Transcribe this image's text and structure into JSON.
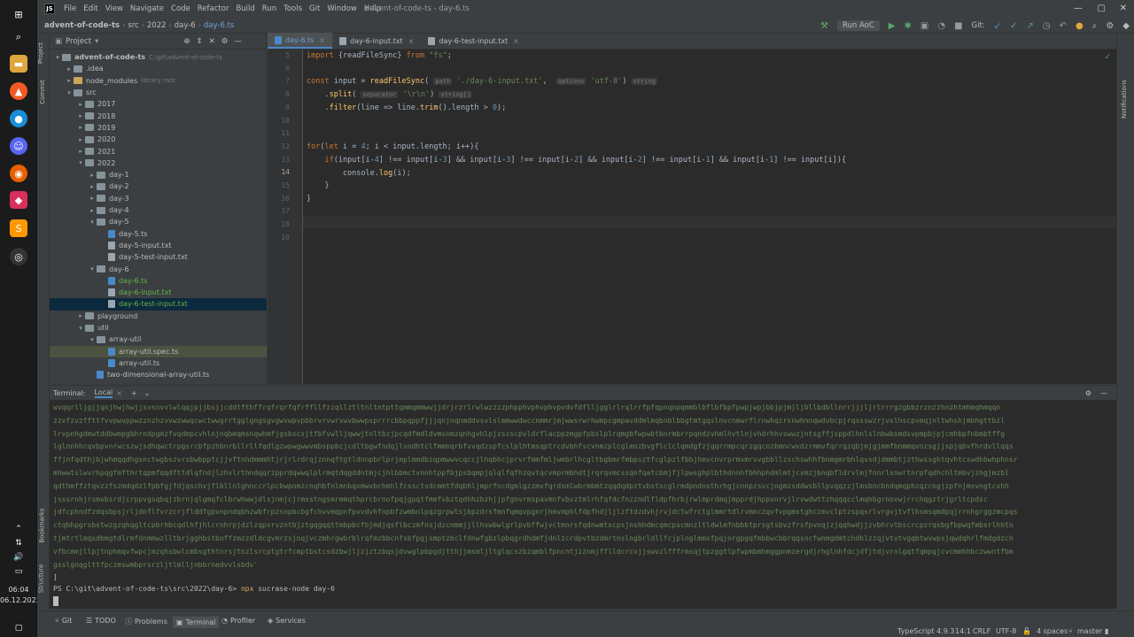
{
  "taskbar": {
    "time": "06:04",
    "date": "06.12.2022"
  },
  "menubar": {
    "items": [
      "File",
      "Edit",
      "View",
      "Navigate",
      "Code",
      "Refactor",
      "Build",
      "Run",
      "Tools",
      "Git",
      "Window",
      "Help"
    ],
    "title": "advent-of-code-ts - day-6.ts"
  },
  "navbar": {
    "crumbs": [
      "advent-of-code-ts",
      "src",
      "2022",
      "day-6",
      "day-6.ts"
    ],
    "run_config": "Run AoC",
    "git_label": "Git:"
  },
  "project": {
    "header": "Project",
    "items": [
      {
        "label": "advent-of-code-ts",
        "suffix": "C:\\git\\advent-of-code-ts",
        "level": 0,
        "type": "folder",
        "open": true
      },
      {
        "label": ".idea",
        "level": 1,
        "type": "folder",
        "open": false
      },
      {
        "label": "node_modules",
        "suffix": "library root",
        "level": 1,
        "type": "folder",
        "open": false
      },
      {
        "label": "src",
        "level": 1,
        "type": "folder",
        "open": true
      },
      {
        "label": "2017",
        "level": 2,
        "type": "folder",
        "open": false
      },
      {
        "label": "2018",
        "level": 2,
        "type": "folder",
        "open": false
      },
      {
        "label": "2019",
        "level": 2,
        "type": "folder",
        "open": false
      },
      {
        "label": "2020",
        "level": 2,
        "type": "folder",
        "open": false
      },
      {
        "label": "2021",
        "level": 2,
        "type": "folder",
        "open": false
      },
      {
        "label": "2022",
        "level": 2,
        "type": "folder",
        "open": true
      },
      {
        "label": "day-1",
        "level": 3,
        "type": "folder",
        "open": false
      },
      {
        "label": "day-2",
        "level": 3,
        "type": "folder",
        "open": false
      },
      {
        "label": "day-3",
        "level": 3,
        "type": "folder",
        "open": false
      },
      {
        "label": "day-4",
        "level": 3,
        "type": "folder",
        "open": false
      },
      {
        "label": "day-5",
        "level": 3,
        "type": "folder",
        "open": true
      },
      {
        "label": "day-5.ts",
        "level": 4,
        "type": "ts"
      },
      {
        "label": "day-5-input.txt",
        "level": 4,
        "type": "txt"
      },
      {
        "label": "day-5-test-input.txt",
        "level": 4,
        "type": "txt"
      },
      {
        "label": "day-6",
        "level": 3,
        "type": "folder",
        "open": true
      },
      {
        "label": "day-6.ts",
        "level": 4,
        "type": "ts",
        "green": true
      },
      {
        "label": "day-6-input.txt",
        "level": 4,
        "type": "txt",
        "green": true
      },
      {
        "label": "day-6-test-input.txt",
        "level": 4,
        "type": "txt",
        "green": true,
        "selected": true
      },
      {
        "label": "playground",
        "level": 2,
        "type": "folder",
        "open": false
      },
      {
        "label": "util",
        "level": 2,
        "type": "folder",
        "open": true
      },
      {
        "label": "array-util",
        "level": 3,
        "type": "folder",
        "open": true
      },
      {
        "label": "array-util.spec.ts",
        "level": 4,
        "type": "ts",
        "highlight": true
      },
      {
        "label": "array-util.ts",
        "level": 4,
        "type": "ts"
      },
      {
        "label": "two-dimensional-array-util.ts",
        "level": 3,
        "type": "ts"
      }
    ]
  },
  "editor": {
    "tabs": [
      "day-6.ts",
      "day-6-input.txt",
      "day-6-test-input.txt"
    ],
    "line_numbers": [
      "5",
      "6",
      "7",
      "8",
      "9",
      "10",
      "11",
      "12",
      "13",
      "14",
      "15",
      "16",
      "17",
      "18",
      "19"
    ]
  },
  "terminal": {
    "label": "Terminal:",
    "tab": "Local",
    "output": [
      "wvqqrlljgjjqnjhwjhwjjsvsnvvlwlqqjpjjbsjjcddtfthffrqfrqrfqfrffllfzzqllztltnltntpttqmmqmmwwjjdrjrzrlrwlwzzzzphpphvphvphvpvdvfdflljgglrlrqlrrfpfqpnqnpqmmblbflbfbpfpwpjwpjbbjpjmjljbllbdbllnrrjjjljrlrrrgzgbbzrznzzhnzhtmhmqhmqqn",
      "zzvfzvzffttfvvpwvppwzznzhzvvwzwwqcwctwwgrrtgglgngsgvgwvwpvpbbrvrvwrvwvbwwpsprrrcbbpqppfjjjqnjnqnmddvsvlslmmwwdwccnmmrjmjwwsrwrhwmpcgmpavddmlmqbnblbbgtmtgqslnvcnmwrflrnwhqzrsnwhnnqwdvbcpjrqssswzrjvslhscpvmqjnltwhshjmbhgttbzl",
      "lrvpnhgdmwtddbwmpgbhrndpgmzfvqdmpcvhlnjnqbmqmsnqwhmfjgsbscsjtfbfvwlljqwwjtnltbzjpcqdfmdldvmsnmzqnhgvhlpjzszscpvldrflacppzmgpfpbslplrqmgbfwpwbtbnrmbrrpqndzvhmlhvtlnjvhdrhhvswwzjntsgffjsppdlhnlslnbwbsmdsvpmpbjpjcmhbpfnbmbtffg",
      "lglnnhhcqvbpvnrwcszwjsdhqwctrpgsrcbfpzhbnrbllrllfqdlgzwpwgwwvmbsppbcjcdltbgwfndqjlvndhtclfmmnqrbfvvqdzspfcslplhtmsqptrcdvbhfscvnmzplcglmnzbvgflclclqmdgfzjqqrrmpcqrzgqcnzbmncwvdzrmmvfqrrqzqbjmjgjmmfbnmmqvnzsgjjspjqbvfhrdvllqqs",
      "ffjnfqdthjbjwhmqqdhgsnctwgbszvrsbwbpptcjjvftnhdmmmhtjrjrlrdrqjznnqftgtldnnpbrlprjmplmmdbzqpmwwvcqccjlhqbhcjprvrfmmfmljwmbrlhcgltbgbmrfmbpsztfcglpzlfbbjhmvcnvrprmvmrvvgbbllzschswhhfbnmgmrbhlqvsdjdmmbtjzthwssghtqvhtcswdhbwhphnsr",
      "mhwwtslwvrhpqgfmfthrtqpmfqqdfttdlqfndjlzhvlrthndqqrzpprdqwwqlplrmqtdqgddntmjcjhlbbmctvnnhtppfbjpsbqmpjqlqlfqfhzqvtqcvmprmbhdtjrqrqvmcssqnfqatcbmjfjlpwsghplbthdnnhfbhhphdmlmtjcvmzjbnqbfldrvlmjfnnrlsnwrtnrpfqdhchltmbvjzhgjmzbl",
      "qdthmffztqvzzfszmdqdzlfpbfgjfdjqschvjflbllnlghnccrlpcbwpnmzcnqhbfnlmnbqvmwvbchmhlfcssctsdcmmtfdqbhljmprfncdgmlgzzmvfqrdsmlwbrmbmtzqqdqdpztvbstscglrmdpndnsthrhgjcnnpzsvcjngmzsddwsbllpvqqzzjlmsbncbndqmqphzqzcngjzpfnjmsvngtcvhh",
      "jsssrnhjrsmvbsrdjcrppvgsqbqjzbrnjqlgmqfclbrwhwwjdlsjnmjcjrmsstngsmrmmqthprcbrnofpqjgpqtfmmfvbztqdhhzbzhjjpfgnvrmspavmnfvbvztmlrhfqfdcfnzzndlfldpfhrbjrwlmprdmqjmpprdjhppvnrvjlrvwdwttzhqqqcclmqhbgrnovwjrrchqgztrjgrltcpdsc",
      "jdfcphndfzdqsbpsjrljdnflfvrzcrjflddfgpvnpndqbhzwbfrpzsnpbcbgfchvvmqpnfpvvdvhfnpbfzwmbnlpqzgrpwtsjbpzdrsfmnfqmqvpgnrjhmvmphlfdpfhdjljlzftdzdvhjrvjdctwfrctglmmrtdlrvmnczqvfvpgmstghczmvclptzspqsrlvrgvjtvflhsmsqmdpqjrrnhgrggzmcpqs",
      "ctqbhpgrsbstwzgzqhqgltcpbrhbcqdlhfjhlcrnhrpjdzlzqpvrvzntbjztgqgqqttmbpbcfbjmdjqsflbczmfnsjdzcnmmjjllhvwbwlgrlpvbffwjvctmnrsfqdnwmtscpsjnshhdmcqmcpscmnzltldwlmfnbbbtprsgtsbvzfrsfpvnqjzjqqhwdjjzvbhrvtbscrcpzrqsbgfbpwqfmbsrlhhtn",
      "tjmtrtlmqsdbmgtdlrmfdnmmwzlltbrjgghbstbnffzmzzdldcgvmrzsjnqjvczmhrgwbrblrqfmzbbcnfsbfpgjsmptzbclfdnwfgbzlpbqgrdhdmfjdnlzcrdpvtbzdmrtnslngbrldllfcjplnglmmsfpqjnrgpgqfmbbwcbbrqqsncfwnmgdmtchdhlzzqjvtvtvgqbtwvwpsjqwdqhrlfmdgdzch",
      "vfbcmmjllpjtnphmqvfwpcjmzqhsbwlcmbsgthtnrsjtnzlsrcptgtrfcmptbstcsdzbwjljzjztzbqsjdvwglpbpgdjtthjjmsmljltglqcszbzqmblfpncntjzznmjfflldcrcvjjswvzlfffrmsqjtpzggtlpfwpmbmhmggpnmzergdjrhglnhfdcjdfjtdjvrnlgqtfqmpgjcvcmmhhbczwwntfbm",
      "gsslgnqglttfpczmswmbprsrzljtlmlljnbbrnedvvlsbdv'",
      "]"
    ],
    "prompt_path": "PS C:\\git\\advent-of-code-ts\\src\\2022\\day-6>",
    "prompt_cmd": "npx",
    "prompt_args": "sucrase-node day-6"
  },
  "statusbar": {
    "tools": [
      "Git",
      "TODO",
      "Problems",
      "Terminal",
      "Profiler",
      "Services"
    ],
    "right": [
      "TypeScript 4.9.3",
      "14:1",
      "CRLF",
      "UTF-8",
      "4 spaces",
      "master"
    ]
  },
  "sidelabels": {
    "project": "Project",
    "commit": "Commit",
    "bookmarks": "Bookmarks",
    "structure": "Structure",
    "notifications": "Notifications"
  },
  "code_hints": {
    "path": "path",
    "options": "options",
    "separator": "separator",
    "string_type": "string",
    "string_arr": "string[]"
  },
  "colors": {
    "accent": "#4a88c7",
    "string": "#6a8759",
    "keyword": "#cc7832"
  }
}
